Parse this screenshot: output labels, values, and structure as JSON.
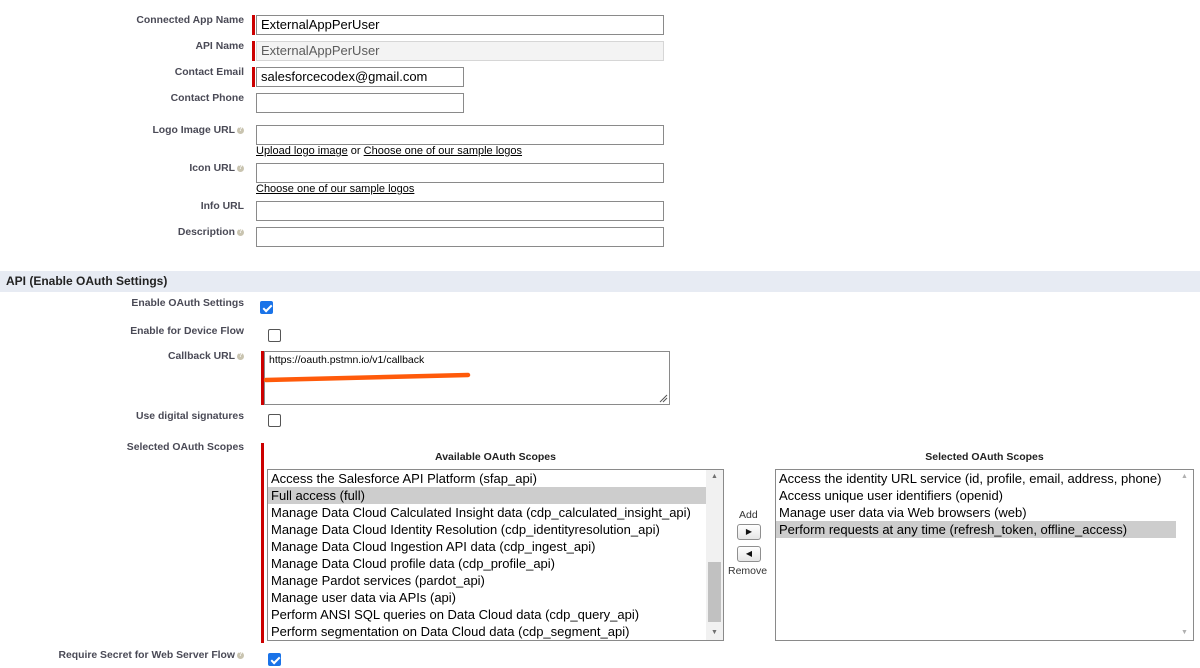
{
  "form": {
    "connected_app_name": {
      "label": "Connected App Name",
      "value": "ExternalAppPerUser"
    },
    "api_name": {
      "label": "API Name",
      "value": "ExternalAppPerUser"
    },
    "contact_email": {
      "label": "Contact Email",
      "value": "salesforcecodex@gmail.com"
    },
    "contact_phone": {
      "label": "Contact Phone",
      "value": ""
    },
    "logo_image_url": {
      "label": "Logo Image URL",
      "value": "",
      "upload_link": "Upload logo image",
      "or_text": "or",
      "sample_link": "Choose one of our sample logos"
    },
    "icon_url": {
      "label": "Icon URL",
      "value": "",
      "sample_link": "Choose one of our sample logos"
    },
    "info_url": {
      "label": "Info URL",
      "value": ""
    },
    "description": {
      "label": "Description",
      "value": ""
    }
  },
  "api_section": {
    "title": "API (Enable OAuth Settings)",
    "enable_oauth": {
      "label": "Enable OAuth Settings",
      "checked": true
    },
    "device_flow": {
      "label": "Enable for Device Flow",
      "checked": false
    },
    "callback_url": {
      "label": "Callback URL",
      "value": "https://oauth.pstmn.io/v1/callback"
    },
    "digital_signatures": {
      "label": "Use digital signatures",
      "checked": false
    },
    "scopes": {
      "label": "Selected OAuth Scopes",
      "available_header": "Available OAuth Scopes",
      "selected_header": "Selected OAuth Scopes",
      "available": [
        "Access the Salesforce API Platform (sfap_api)",
        "Full access (full)",
        "Manage Data Cloud Calculated Insight data (cdp_calculated_insight_api)",
        "Manage Data Cloud Identity Resolution (cdp_identityresolution_api)",
        "Manage Data Cloud Ingestion API data (cdp_ingest_api)",
        "Manage Data Cloud profile data (cdp_profile_api)",
        "Manage Pardot services (pardot_api)",
        "Manage user data via APIs (api)",
        "Perform ANSI SQL queries on Data Cloud data (cdp_query_api)",
        "Perform segmentation on Data Cloud data (cdp_segment_api)"
      ],
      "available_highlighted": "Full access (full)",
      "selected": [
        "Access the identity URL service (id, profile, email, address, phone)",
        "Access unique user identifiers (openid)",
        "Manage user data via Web browsers (web)",
        "Perform requests at any time (refresh_token, offline_access)"
      ],
      "selected_highlighted": "Perform requests at any time (refresh_token, offline_access)",
      "available_scroll_fraction": 0.85,
      "add_label": "Add",
      "remove_label": "Remove"
    },
    "require_secret": {
      "label": "Require Secret for Web Server Flow",
      "checked": true
    }
  },
  "icons": {
    "help": "help-icon",
    "add_arrow": "right-arrow-icon",
    "remove_arrow": "left-arrow-icon",
    "annotation": "orange-underline-annotation"
  },
  "colors": {
    "required_bar": "#c00000",
    "section_bg": "#e7ebf3",
    "checkbox_checked": "#1a73e8",
    "annotation": "#ff5a0a",
    "selected_option": "#cdcdcd"
  }
}
